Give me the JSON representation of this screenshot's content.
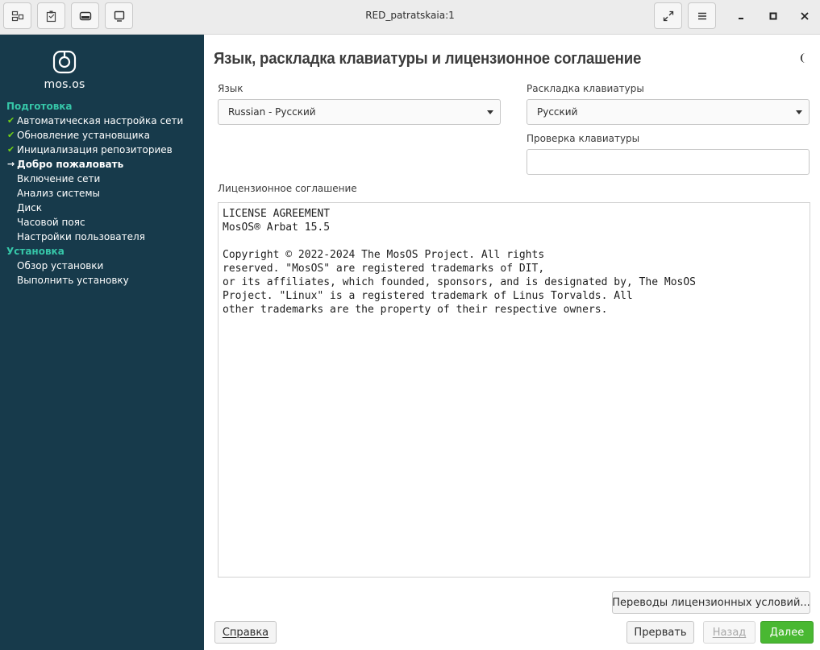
{
  "window": {
    "title": "RED_patratskaia:1"
  },
  "icons": {
    "toolbar": [
      "windows-icon",
      "clipboard-icon",
      "keyboard-icon",
      "display-icon"
    ],
    "fullscreen": "fullscreen-icon",
    "menu": "hamburger-menu-icon",
    "theme": "half-moon-icon"
  },
  "colors": {
    "sidebar_bg": "#173a4b",
    "section_accent": "#36c6a8",
    "check": "#73d216",
    "primary_button": "#49b832"
  },
  "sidebar": {
    "logo_text": "mos.os",
    "sections": [
      {
        "title": "Подготовка",
        "items": [
          {
            "label": "Автоматическая настройка сети",
            "state": "done"
          },
          {
            "label": "Обновление установщика",
            "state": "done"
          },
          {
            "label": "Инициализация репозиториев",
            "state": "done"
          },
          {
            "label": "Добро пожаловать",
            "state": "current"
          },
          {
            "label": "Включение сети",
            "state": "pending"
          },
          {
            "label": "Анализ системы",
            "state": "pending"
          },
          {
            "label": "Диск",
            "state": "pending"
          },
          {
            "label": "Часовой пояс",
            "state": "pending"
          },
          {
            "label": "Настройки пользователя",
            "state": "pending"
          }
        ]
      },
      {
        "title": "Установка",
        "items": [
          {
            "label": "Обзор установки",
            "state": "pending"
          },
          {
            "label": "Выполнить установку",
            "state": "pending"
          }
        ]
      }
    ]
  },
  "main": {
    "title": "Язык, раскладка клавиатуры и лицензионное соглашение",
    "language": {
      "label": "Язык",
      "value": "Russian - Русский"
    },
    "keyboard_layout": {
      "label": "Раскладка клавиатуры",
      "value": "Русский"
    },
    "keyboard_test": {
      "label": "Проверка клавиатуры",
      "value": ""
    },
    "license": {
      "label": "Лицензионное соглашение",
      "text": "LICENSE AGREEMENT\nMosOS® Arbat 15.5\n\nCopyright © 2022-2024 The MosOS Project. All rights\nreserved. \"MosOS\" are registered trademarks of DIT,\nor its affiliates, which founded, sponsors, and is designated by, The MosOS\nProject. \"Linux\" is a registered trademark of Linus Torvalds. All\nother trademarks are the property of their respective owners."
    },
    "translations_button": "Переводы лицензионных условий..."
  },
  "footer": {
    "help": "Справка",
    "abort": "Прервать",
    "back": "Назад",
    "next": "Далее"
  }
}
